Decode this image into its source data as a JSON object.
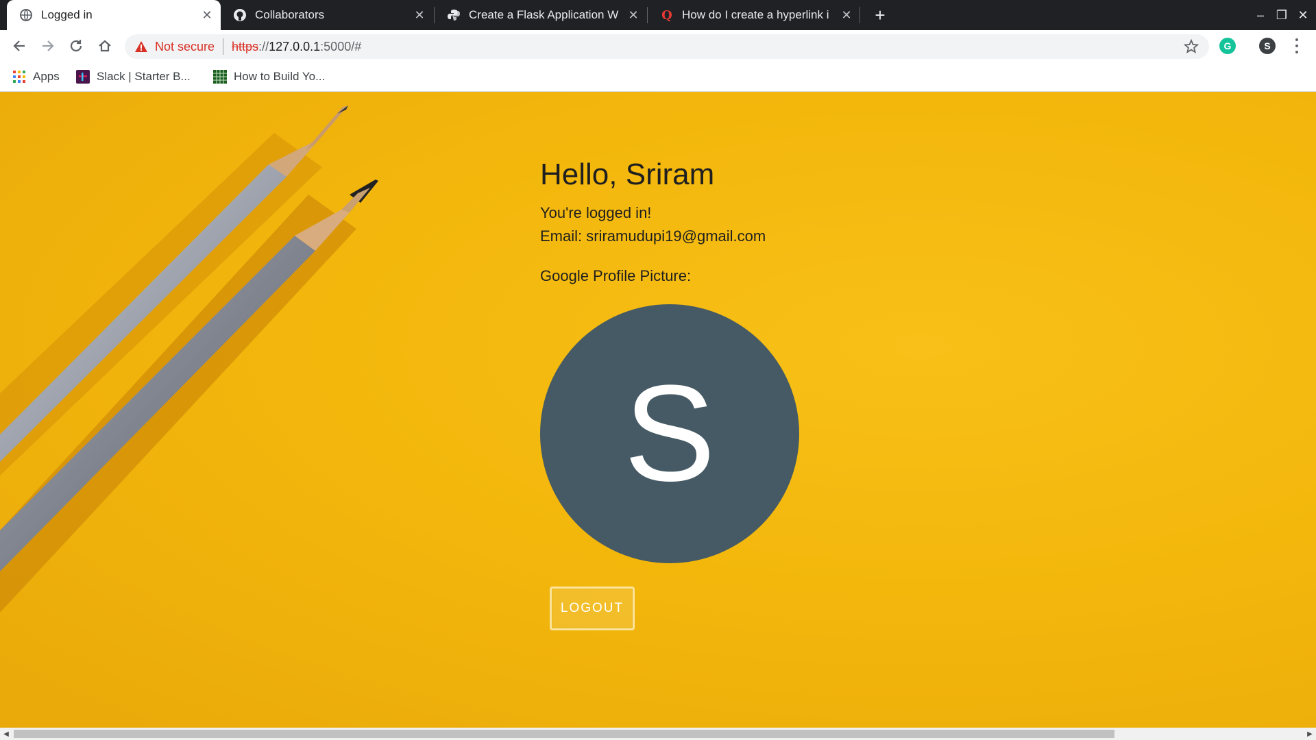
{
  "tabs": [
    {
      "title": "Logged in",
      "icon": "globe-icon",
      "active": true
    },
    {
      "title": "Collaborators",
      "icon": "github-icon",
      "active": false
    },
    {
      "title": "Create a Flask Application W",
      "icon": "python-icon",
      "active": false
    },
    {
      "title": "How do I create a hyperlink i",
      "icon": "quora-icon",
      "active": false
    }
  ],
  "new_tab_symbol": "+",
  "window_controls": {
    "minimize": "–",
    "restore": "❐",
    "close": "✕"
  },
  "omnibox": {
    "security_label": "Not secure",
    "url_scheme": "https",
    "url_separator": "://",
    "url_host": "127.0.0.1",
    "url_path": ":5000/#"
  },
  "profile_initial": "S",
  "bookmarks": [
    {
      "label": "Apps",
      "icon": "apps-grid-icon"
    },
    {
      "label": "Slack | Starter B...",
      "icon": "slack-icon"
    },
    {
      "label": "How to Build Yo...",
      "icon": "grid-site-icon"
    }
  ],
  "page": {
    "greeting": "Hello, Sriram",
    "status": "You're logged in!",
    "email_line": "Email: sriramudupi19@gmail.com",
    "profile_picture_label": "Google Profile Picture:",
    "avatar_letter": "S",
    "logout_label": "LOGOUT"
  },
  "colors": {
    "background": "#f3b70c",
    "avatar": "#455a64",
    "not_secure": "#d93025",
    "grammarly": "#15c39a"
  }
}
